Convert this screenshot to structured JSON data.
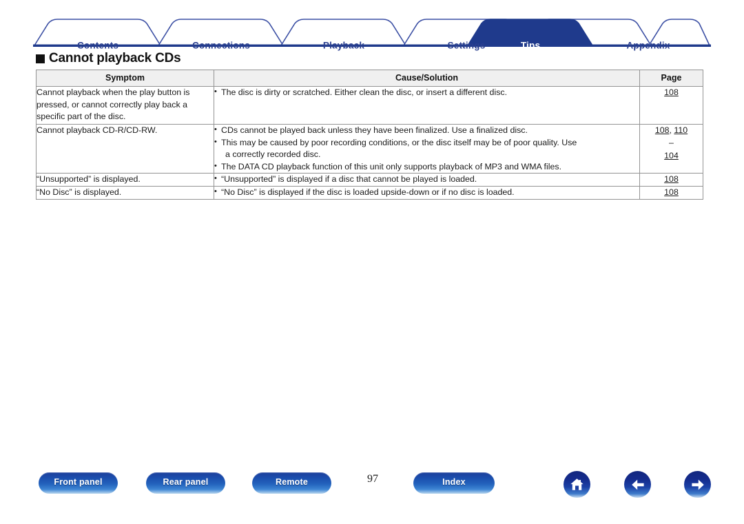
{
  "tabs": [
    {
      "label": "Contents",
      "active": false
    },
    {
      "label": "Connections",
      "active": false
    },
    {
      "label": "Playback",
      "active": false
    },
    {
      "label": "Settings",
      "active": false
    },
    {
      "label": "Tips",
      "active": true
    },
    {
      "label": "Appendix",
      "active": false
    }
  ],
  "heading": "Cannot playback CDs",
  "table": {
    "columns": [
      "Symptom",
      "Cause/Solution",
      "Page"
    ],
    "rows": [
      {
        "symptom": "Cannot playback when the play button is pressed, or cannot correctly play back a specific part of the disc.",
        "causes": [
          {
            "text": "The disc is dirty or scratched. Either clean the disc, or insert a different disc.",
            "continuation": ""
          }
        ],
        "pages": [
          "108"
        ]
      },
      {
        "symptom": "Cannot playback CD-R/CD-RW.",
        "causes": [
          {
            "text": "CDs cannot be played back unless they have been finalized. Use a finalized disc.",
            "continuation": ""
          },
          {
            "text": "This may be caused by poor recording conditions, or the disc itself may be of poor quality. Use",
            "continuation": "a correctly recorded disc."
          },
          {
            "text": "The DATA CD playback function of this unit only supports playback of MP3 and WMA files.",
            "continuation": ""
          }
        ],
        "pages": [
          "108",
          "110",
          "–",
          "104"
        ]
      },
      {
        "symptom": "“Unsupported” is displayed.",
        "causes": [
          {
            "text": "“Unsupported” is displayed if a disc that cannot be played is loaded.",
            "continuation": ""
          }
        ],
        "pages": [
          "108"
        ]
      },
      {
        "symptom": "“No Disc” is displayed.",
        "causes": [
          {
            "text": "“No Disc” is displayed if the disc is loaded upside-down or if no disc is loaded.",
            "continuation": ""
          }
        ],
        "pages": [
          "108"
        ]
      }
    ]
  },
  "footer": {
    "front_panel": "Front panel",
    "rear_panel": "Rear panel",
    "remote": "Remote",
    "index": "Index",
    "page_number": "97",
    "icons": {
      "home": "home-icon",
      "back": "arrow-left-icon",
      "next": "arrow-right-icon"
    }
  },
  "colors": {
    "tab_active_bg": "#1f3a8c",
    "tab_text": "#2a3f8f",
    "tab_rule": "#1f3a8c",
    "header_bg": "#f0f0f0",
    "border": "#939393"
  }
}
